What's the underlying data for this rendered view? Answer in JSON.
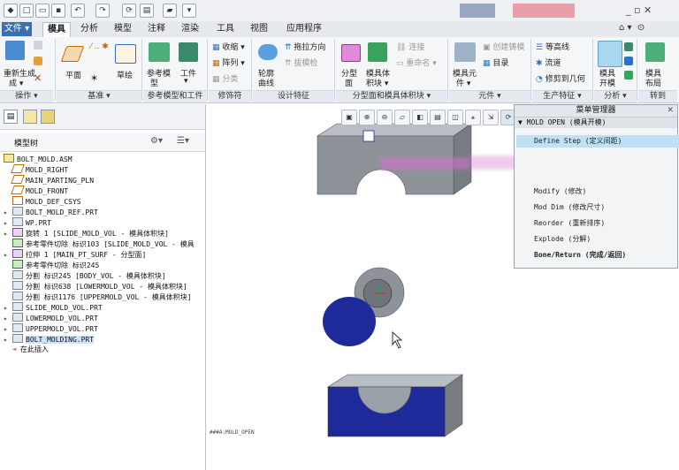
{
  "tabs": [
    "文件 ▾",
    "模具",
    "分析",
    "模型",
    "注释",
    "渲染",
    "工具",
    "视图",
    "应用程序"
  ],
  "active_tab": "模具",
  "ribbon": {
    "regen": "重新生成",
    "regen2": "成 ▾",
    "plane": "平面",
    "sketch": "草绘",
    "ref_model1": "参考模",
    "ref_model2": "型",
    "workpiece1": "工件",
    "workpiece2": "▾",
    "shrink": "收缩 ▾",
    "array": "阵列 ▾",
    "split": "分类",
    "contour1": "轮廓",
    "contour2": "曲线",
    "draft_dir": "拖拉方向",
    "draft_check": "拔模检",
    "parting1": "分型",
    "parting2": "面",
    "mold_vol1": "模具体",
    "mold_vol2": "积块 ▾",
    "connect": "连接",
    "rename": "重命名 ▾",
    "mold_comp1": "模具元",
    "mold_comp2": "件 ▾",
    "create_cast": "创建铸模",
    "catalog": "目录",
    "contour_line": "等高线",
    "flow": "流道",
    "trim_geo": "修剪到几何",
    "mold_open1": "模具",
    "mold_open2": "开模",
    "mold_layout1": "模具",
    "mold_layout2": "布局",
    "groups": {
      "ops": "操作 ▾",
      "datum": "基准 ▾",
      "refwork": "参考模型和工件",
      "modifiers": "修饰符",
      "design": "设计特征",
      "parting": "分型面和模具体积块 ▾",
      "comps": "元件 ▾",
      "production": "生产特征 ▾",
      "analysis": "分析 ▾",
      "goto": "转到"
    }
  },
  "panel": {
    "title": "模型树",
    "items": [
      "BOLT_MOLD.ASM",
      "MOLD_RIGHT",
      "MAIN_PARTING_PLN",
      "MOLD_FRONT",
      "MOLD_DEF_CSYS",
      "BOLT_MOLD_REF.PRT",
      "WP.PRT",
      "旋转 1 [SLIDE_MOLD_VOL - 模具体积块]",
      "参考零件切除 标识103 [SLIDE_MOLD_VOL - 模具",
      "拉伸 1 [MAIN_PT_SURF - 分型面]",
      "参考零件切除 标识245",
      "分割 标识245 [BODY_VOL - 模具体积块]",
      "分割 标识638 [LOWERMOLD_VOL - 模具体积块]",
      "分割 标识1176 [UPPERMOLD_VOL - 模具体积块]",
      "SLIDE_MOLD_VOL.PRT",
      "LOWERMOLD_VOL.PRT",
      "UPPERMOLD_VOL.PRT",
      "BOLT_MOLDING.PRT",
      "在此插入"
    ]
  },
  "menu_manager": {
    "title": "菜单管理器",
    "subtitle": "▼ MOLD OPEN (模具开模)",
    "items": [
      "Define Step (定义间距)",
      "Modify (修改)",
      "Mod Dim (修改尺寸)",
      "Reorder (重新排序)",
      "Explode (分解)",
      "Bone/Return (完成/返回)"
    ]
  },
  "graphics": {
    "corner_label": "###A:MOLD_OPEN"
  },
  "colors": {
    "file_tab": "#3b6fb2",
    "highlight": "#bfe0f5",
    "mold_gray": "#8e939a",
    "mold_blue": "#1f2a9a"
  }
}
